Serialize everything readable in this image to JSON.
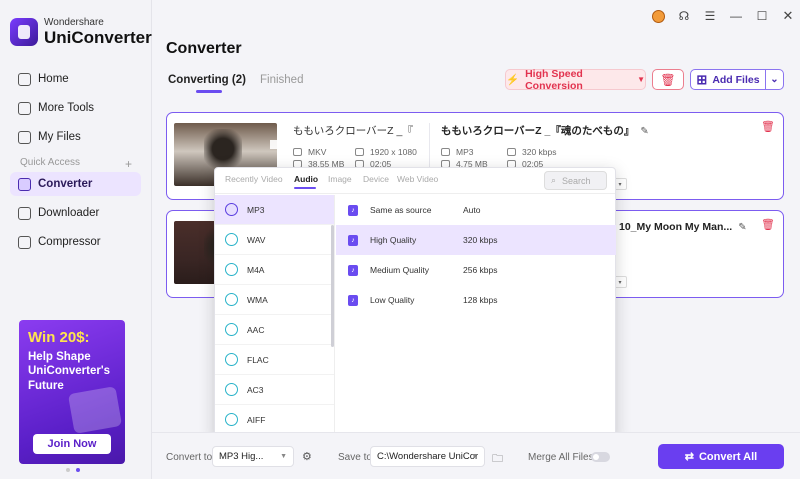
{
  "app": {
    "logo_small": "Wondershare",
    "logo_big": "UniConverter"
  },
  "sidebar": {
    "items": [
      {
        "label": "Home",
        "icon": "home-icon"
      },
      {
        "label": "More Tools",
        "icon": "tools-icon"
      },
      {
        "label": "My Files",
        "icon": "files-icon"
      },
      {
        "label": "Converter",
        "icon": "converter-icon",
        "active": true
      },
      {
        "label": "Downloader",
        "icon": "downloader-icon"
      },
      {
        "label": "Compressor",
        "icon": "compressor-icon"
      }
    ],
    "quick_access": "Quick Access",
    "quick_access_plus": "+"
  },
  "promo": {
    "title": "Win 20$:",
    "subtitle": "Help Shape UniConverter's Future",
    "button": "Join Now"
  },
  "titlebar": {
    "icons": [
      "avatar-icon",
      "headset-icon",
      "menu-icon",
      "minimize-icon",
      "maximize-icon",
      "close-icon"
    ],
    "glyphs": [
      "",
      "☊",
      "☰",
      "—",
      "☐",
      "✕"
    ]
  },
  "main": {
    "title": "Converter",
    "tabs": [
      {
        "label": "Converting (2)",
        "active": true
      },
      {
        "label": "Finished",
        "active": false
      }
    ],
    "high_speed": "High Speed Conversion",
    "add_files": "Add Files"
  },
  "files": [
    {
      "source_name": "ももいろクローバーZ _『...",
      "source_format": "MKV",
      "source_size": "38.55 MB",
      "source_resolution": "1920 x 1080",
      "source_duration": "02:05",
      "target_name": "ももいろクローバーZ _『魂のたべもの』",
      "target_format": "MP3",
      "target_size": "4.75 MB",
      "target_bitrate": "320 kbps",
      "target_duration": "02:05"
    },
    {
      "target_name": "10_My Moon My Man..."
    }
  ],
  "format_popup": {
    "tabs": [
      "Recently",
      "Video",
      "Audio",
      "Image",
      "Device",
      "Web Video"
    ],
    "active_tab": "Audio",
    "search_placeholder": "Search",
    "formats": [
      "MP3",
      "WAV",
      "M4A",
      "WMA",
      "AAC",
      "FLAC",
      "AC3",
      "AIFF"
    ],
    "format_icon_labels": [
      "MP3",
      "WAV",
      "M4A",
      "WMA",
      "AAC",
      "FLAC",
      "AC3",
      "AIFF"
    ],
    "selected_format": "MP3",
    "qualities": [
      {
        "label": "Same as source",
        "rate": "Auto"
      },
      {
        "label": "High Quality",
        "rate": "320 kbps",
        "active": true
      },
      {
        "label": "Medium Quality",
        "rate": "256 kbps"
      },
      {
        "label": "Low Quality",
        "rate": "128 kbps"
      }
    ]
  },
  "bottom": {
    "convert_to_label": "Convert to",
    "convert_to_value": "MP3 Hig...",
    "save_to_label": "Save to",
    "save_to_value": "C:\\Wondershare UniCor",
    "merge_label": "Merge All Files",
    "merge_on": false,
    "convert_all": "Convert All"
  },
  "colors": {
    "accent": "#6a3ef0",
    "danger": "#e2334f",
    "active_bg": "#ece4ff"
  }
}
